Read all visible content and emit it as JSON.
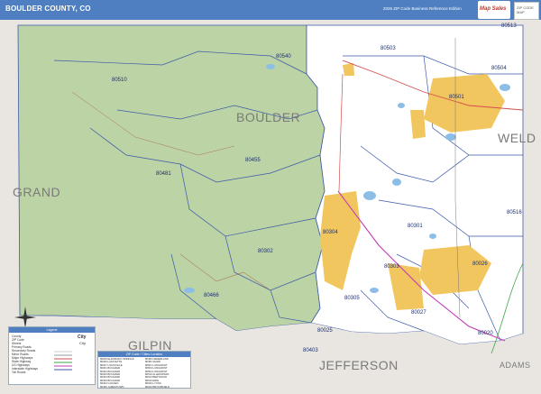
{
  "header": {
    "title": "BOULDER COUNTY, CO",
    "edition": "2026 ZIP Code Business Reference Edition",
    "logo": "Map Sales",
    "badge": "ZIP CODE MAP"
  },
  "colors": {
    "header": "#4f7fc0",
    "forest": "#bcd3a6",
    "urban": "#f2c65e",
    "water": "#8cbde6",
    "boundary": "#3c5aa8",
    "outside": "#e9e6e1"
  },
  "counties": {
    "boulder": "BOULDER",
    "grand": "GRAND",
    "gilpin": "GILPIN",
    "jefferson": "JEFFERSON",
    "weld": "WELD",
    "adams": "ADAMS"
  },
  "zips": [
    "80510",
    "80540",
    "80503",
    "80513",
    "80504",
    "80501",
    "80481",
    "80455",
    "80302",
    "80466",
    "80304",
    "80301",
    "80516",
    "80303",
    "80026",
    "80305",
    "80027",
    "80025",
    "80403",
    "80020"
  ],
  "legend": {
    "title": "Legend",
    "items": [
      "County",
      "ZIP Code",
      "Streets",
      "Primary Roads",
      "Secondary Roads",
      "Minor Roads",
      "Major Highways",
      "State Highway",
      "US Highways",
      "Interstate Highways",
      "Toll Roads"
    ],
    "city_labels": [
      "City",
      "City"
    ]
  },
  "index": {
    "title": "ZIP Code / Cities Location",
    "rows": [
      "80025 ELDORADO SPRINGS",
      "80026 LAFAYETTE",
      "80027 LOUISVILLE",
      "80301 BOULDER",
      "80302 BOULDER",
      "80303 BOULDER",
      "80304 BOULDER",
      "80305 BOULDER",
      "80403 GOLDEN",
      "80455 JAMESTOWN",
      "80466 NEDERLAND",
      "80481 WARD",
      "80501 LONGMONT",
      "80503 LONGMONT",
      "80504 LONGMONT",
      "80510 ALLENSPARK",
      "80513 BERTHOUD",
      "80516 ERIE",
      "80540 LYONS",
      "80020 BROOMFIELD"
    ]
  }
}
